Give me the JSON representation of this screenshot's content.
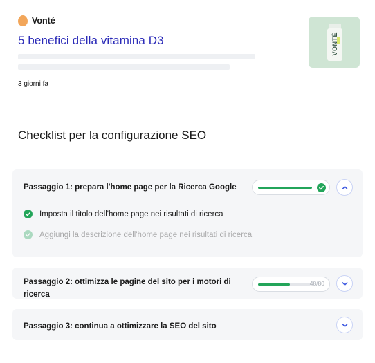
{
  "search_result": {
    "brand": "Vonté",
    "title": "5 benefici della vitamina D3",
    "date": "3 giorni fa",
    "thumbnail_label": "VONTÉ"
  },
  "checklist": {
    "title": "Checklist per la configurazione SEO",
    "steps": [
      {
        "title": "Passaggio 1: prepara l'home page per la Ricerca Google",
        "progress": 1.0,
        "completed": true,
        "expanded": true,
        "items": [
          {
            "label": "Imposta il titolo dell'home page nei risultati di ricerca",
            "done": true
          },
          {
            "label": "Aggiungi la descrizione dell'home page nei risultati di ricerca",
            "done": true
          }
        ]
      },
      {
        "title": "Passaggio 2: ottimizza le pagine del sito per i motori di ricerca",
        "progress_text": "48/80",
        "progress": 0.6,
        "completed": false,
        "expanded": false
      },
      {
        "title": "Passaggio 3: continua a ottimizzare la SEO del sito",
        "completed": false,
        "expanded": false
      }
    ]
  },
  "colors": {
    "title_link": "#2b2bb8",
    "success": "#23a55a",
    "brand_accent": "#f2a65a",
    "card_bg": "#f5f6f8",
    "chevron": "#3a56e0"
  },
  "icons": {
    "brand": "brand-blob-icon",
    "check": "check-circle-icon",
    "expand": "chevron-down-icon",
    "collapse": "chevron-up-icon"
  }
}
